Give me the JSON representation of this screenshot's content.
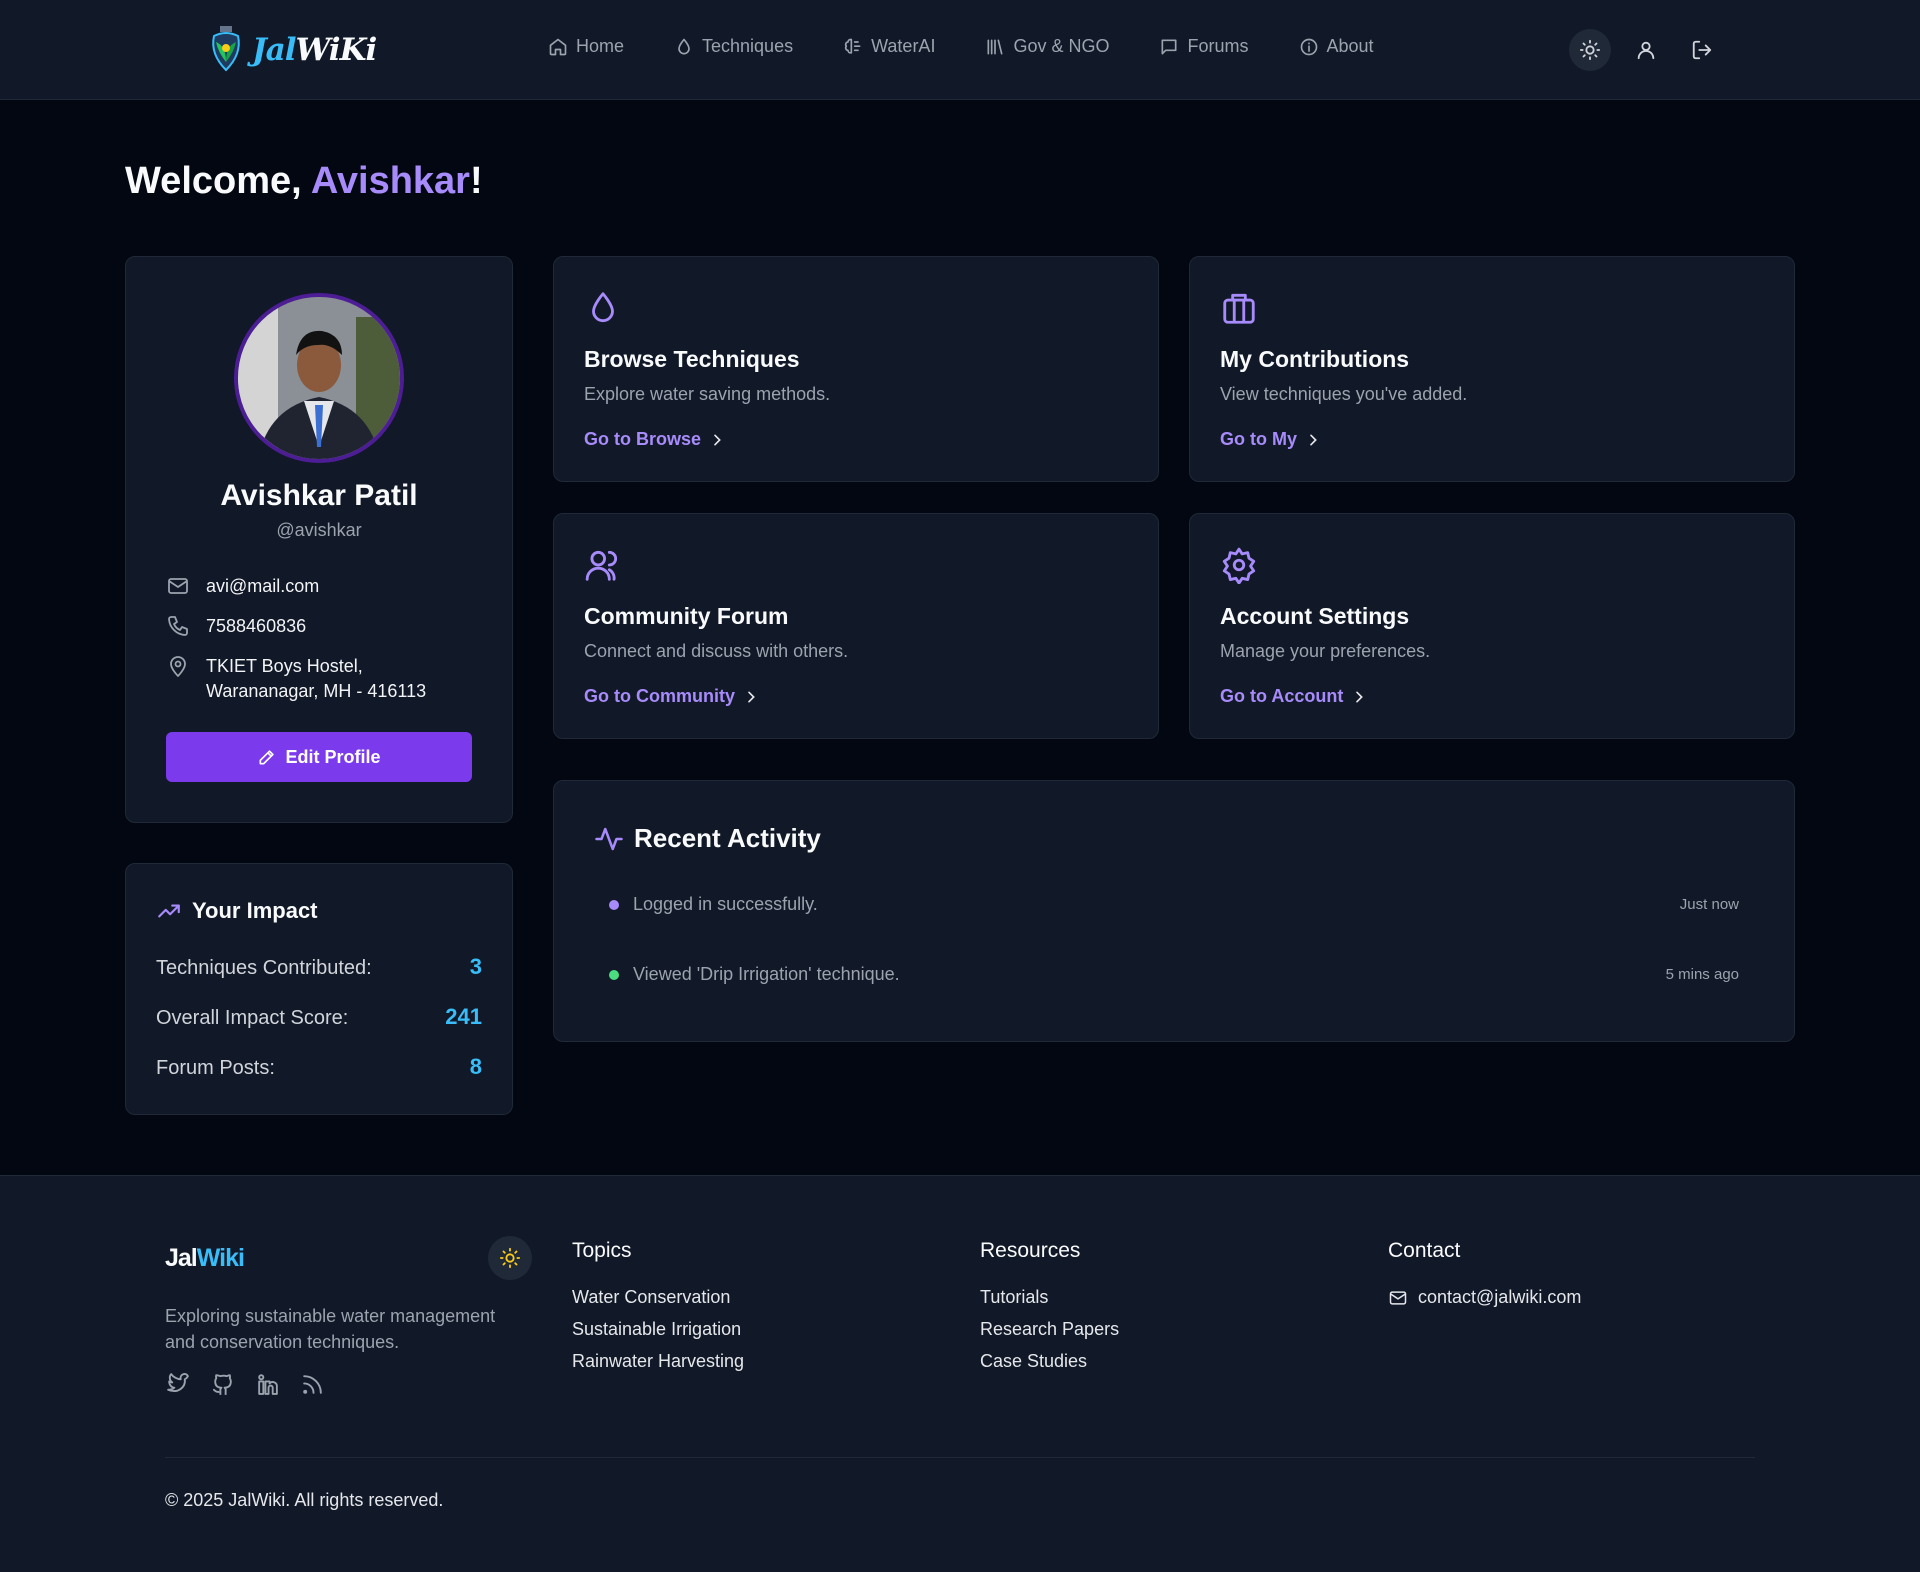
{
  "brand": {
    "logo_jal": "Jal",
    "logo_wiki": "WiKi",
    "footer_jal": "Jal",
    "footer_wiki": "Wiki"
  },
  "nav": {
    "items": [
      {
        "label": "Home",
        "icon": "home-icon"
      },
      {
        "label": "Techniques",
        "icon": "droplet-icon"
      },
      {
        "label": "WaterAI",
        "icon": "brain-icon"
      },
      {
        "label": "Gov & NGO",
        "icon": "library-icon"
      },
      {
        "label": "Forums",
        "icon": "chat-icon"
      },
      {
        "label": "About",
        "icon": "info-icon"
      }
    ]
  },
  "welcome": {
    "prefix": "Welcome, ",
    "name": "Avishkar",
    "suffix": "!"
  },
  "profile": {
    "name": "Avishkar Patil",
    "handle": "@avishkar",
    "email": "avi@mail.com",
    "phone": "7588460836",
    "address_line1": "TKIET Boys Hostel,",
    "address_line2": "Warananagar, MH - 416113",
    "edit_label": "Edit Profile"
  },
  "impact": {
    "title": "Your Impact",
    "rows": [
      {
        "label": "Techniques Contributed:",
        "value": "3"
      },
      {
        "label": "Overall Impact Score:",
        "value": "241"
      },
      {
        "label": "Forum Posts:",
        "value": "8"
      }
    ]
  },
  "cards": [
    {
      "title": "Browse Techniques",
      "desc": "Explore water saving methods.",
      "link": "Go to Browse",
      "icon": "droplet-icon"
    },
    {
      "title": "My Contributions",
      "desc": "View techniques you've added.",
      "link": "Go to My",
      "icon": "briefcase-icon"
    },
    {
      "title": "Community Forum",
      "desc": "Connect and discuss with others.",
      "link": "Go to Community",
      "icon": "users-icon"
    },
    {
      "title": "Account Settings",
      "desc": "Manage your preferences.",
      "link": "Go to Account",
      "icon": "gear-icon"
    }
  ],
  "activity": {
    "title": "Recent Activity",
    "items": [
      {
        "text": "Logged in successfully.",
        "time": "Just now",
        "color": "#a78bfa"
      },
      {
        "text": "Viewed 'Drip Irrigation' technique.",
        "time": "5 mins ago",
        "color": "#4ade80"
      }
    ]
  },
  "footer": {
    "tagline": "Exploring sustainable water management and conservation techniques.",
    "topics": {
      "title": "Topics",
      "links": [
        "Water Conservation",
        "Sustainable Irrigation",
        "Rainwater Harvesting"
      ]
    },
    "resources": {
      "title": "Resources",
      "links": [
        "Tutorials",
        "Research Papers",
        "Case Studies"
      ]
    },
    "contact": {
      "title": "Contact",
      "email": "contact@jalwiki.com"
    },
    "copyright": "© 2025 JalWiki. All rights reserved."
  },
  "colors": {
    "accent": "#a78bfa",
    "primary_button": "#7c3aed",
    "stat": "#38bdf8",
    "bg": "#030712",
    "card": "#111827"
  }
}
